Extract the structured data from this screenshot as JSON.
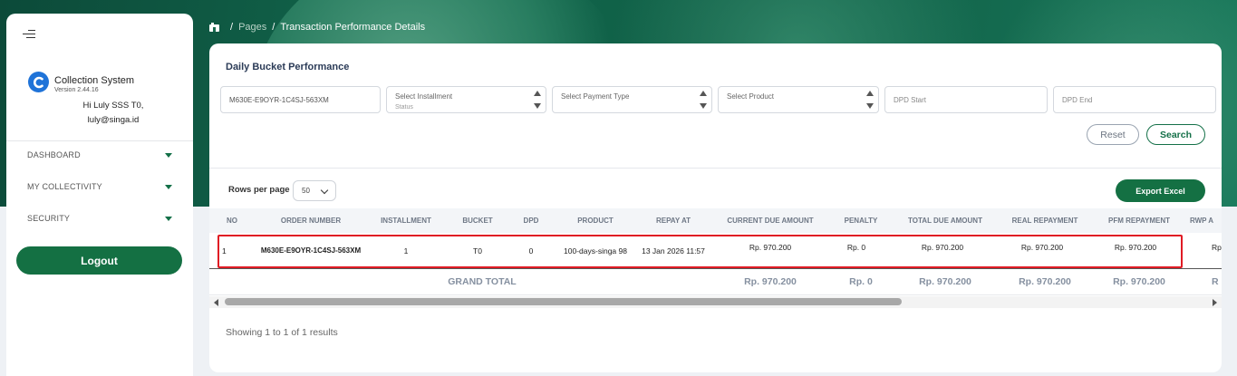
{
  "sidebar": {
    "brand_name": "Collection System",
    "version": "Version 2.44.16",
    "greeting": "Hi Luly SSS T0,",
    "email": "luly@singa.id",
    "menu": [
      {
        "label": "DASHBOARD"
      },
      {
        "label": "MY COLLECTIVITY"
      },
      {
        "label": "SECURITY"
      }
    ],
    "logout_label": "Logout"
  },
  "breadcrumb": {
    "pages": "Pages",
    "current": "Transaction Performance Details"
  },
  "filters": {
    "title": "Daily Bucket Performance",
    "order_number_value": "M630E-E9OYR-1C4SJ-563XM",
    "installment_status_placeholder": "Select Installment",
    "installment_status_sub": "Status",
    "payment_type_placeholder": "Select Payment Type",
    "product_placeholder": "Select Product",
    "dpd_start_placeholder": "DPD Start",
    "dpd_end_placeholder": "DPD End",
    "reset_label": "Reset",
    "search_label": "Search"
  },
  "table_controls": {
    "rows_per_page_label": "Rows per page",
    "rows_per_page_value": "50",
    "export_label": "Export Excel"
  },
  "table": {
    "columns": [
      "NO",
      "ORDER NUMBER",
      "INSTALLMENT",
      "BUCKET",
      "DPD",
      "PRODUCT",
      "REPAY AT",
      "CURRENT DUE AMOUNT",
      "PENALTY",
      "TOTAL DUE AMOUNT",
      "REAL REPAYMENT",
      "PFM REPAYMENT",
      "RWP A"
    ],
    "rows": [
      {
        "no": "1",
        "order_number": "M630E-E9OYR-1C4SJ-563XM",
        "installment": "1",
        "bucket": "T0",
        "dpd": "0",
        "product": "100-days-singa 98",
        "repay_at": "13 Jan 2026 11:57",
        "current_due_amount": "Rp. 970.200",
        "penalty": "Rp. 0",
        "total_due_amount": "Rp. 970.200",
        "real_repayment": "Rp. 970.200",
        "pfm_repayment": "Rp. 970.200",
        "rwp": "Rp"
      }
    ],
    "grand_total": {
      "label": "GRAND TOTAL",
      "current_due_amount": "Rp. 970.200",
      "penalty": "Rp. 0",
      "total_due_amount": "Rp. 970.200",
      "real_repayment": "Rp. 970.200",
      "pfm_repayment": "Rp. 970.200",
      "rwp": "R"
    },
    "showing_text": "Showing 1 to 1 of 1 results"
  },
  "colors": {
    "primary_green": "#147043",
    "highlight_red": "#e01b24",
    "logo_blue": "#1f73d8"
  },
  "icons": [
    "menu-icon",
    "home-icon",
    "caret-down-icon",
    "chevron-down-icon",
    "scroll-left-icon",
    "scroll-right-icon"
  ]
}
